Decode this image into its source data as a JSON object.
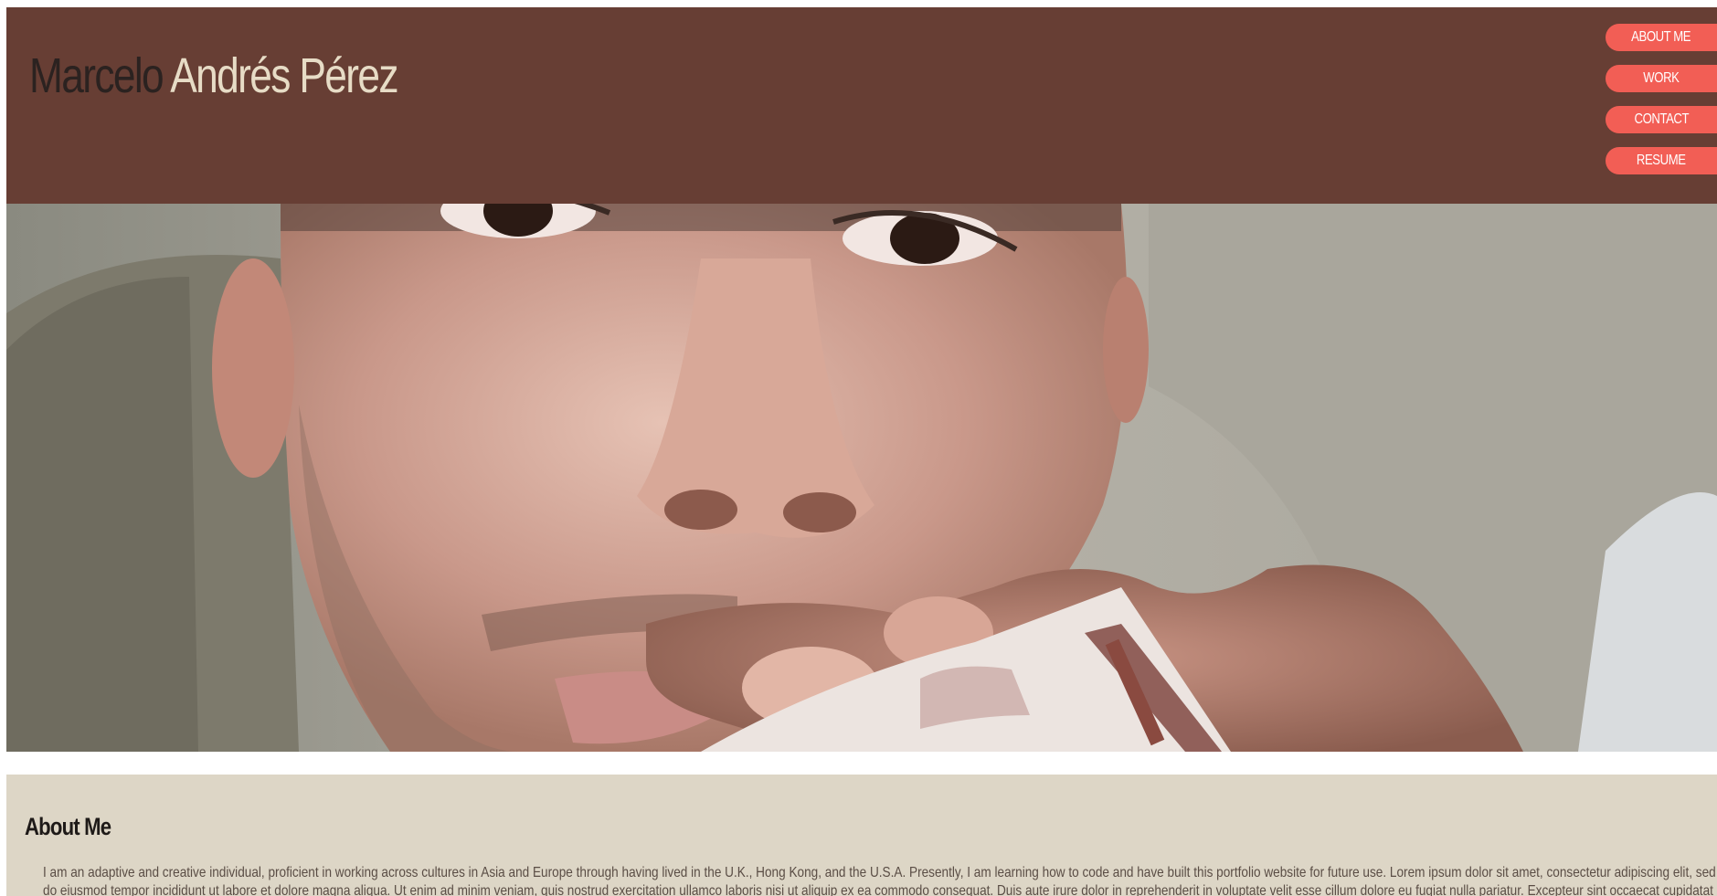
{
  "header": {
    "first_name": "Marcelo",
    "last_name": "Andrés Pérez",
    "nav": [
      "ABOUT ME",
      "WORK",
      "CONTACT",
      "RESUME"
    ]
  },
  "about": {
    "title": "About Me",
    "text": "I am an adaptive and creative individual, proficient in working across cultures in Asia and Europe through having lived in the U.K., Hong Kong, and the U.S.A. Presently, I am learning how to code and have built this portfolio website for future use. Lorem ipsum dolor sit amet, consectetur adipiscing elit, sed do eiusmod tempor incididunt ut labore et dolore magna aliqua. Ut enim ad minim veniam, quis nostrud exercitation ullamco laboris nisi ut aliquip ex ea commodo consequat. Duis aute irure dolor in reprehenderit in voluptate velit esse cillum dolore eu fugiat nulla pariatur. Excepteur sint occaecat cupidatat non proident, sunt in culpa qui officia deserunt mollit anim id est laborum."
  },
  "colors": {
    "header_bg": "#673e34",
    "nav_bg": "#f25e55",
    "about_bg": "#ddd6c6",
    "name_dark": "#2b2220",
    "name_light": "#e7dcc6"
  }
}
